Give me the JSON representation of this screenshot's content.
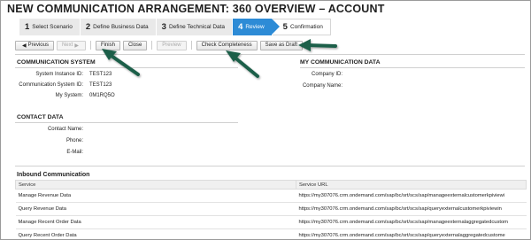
{
  "page": {
    "title": "NEW COMMUNICATION ARRANGEMENT: 360 OVERVIEW – ACCOUNT"
  },
  "steps": [
    {
      "num": "1",
      "label": "Select Scenario"
    },
    {
      "num": "2",
      "label": "Define Business Data"
    },
    {
      "num": "3",
      "label": "Define Technical Data"
    },
    {
      "num": "4",
      "label": "Review"
    },
    {
      "num": "5",
      "label": "Confirmation"
    }
  ],
  "toolbar": {
    "previous_label": "Previous",
    "next_label": "Next",
    "finish_label": "Finish",
    "close_label": "Close",
    "preview_label": "Preview",
    "check_label": "Check Completeness",
    "draft_label": "Save as Draft"
  },
  "communication_system": {
    "title": "COMMUNICATION SYSTEM",
    "fields": [
      {
        "label": "System Instance ID:",
        "value": "TEST123"
      },
      {
        "label": "Communication System ID:",
        "value": "TEST123"
      },
      {
        "label": "My System:",
        "value": "0M1RQ5O"
      }
    ]
  },
  "my_communication_data": {
    "title": "MY COMMUNICATION DATA",
    "fields": [
      {
        "label": "Company ID:",
        "value": ""
      },
      {
        "label": "Company Name:",
        "value": ""
      }
    ]
  },
  "contact_data": {
    "title": "CONTACT DATA",
    "fields": [
      {
        "label": "Contact Name:",
        "value": ""
      },
      {
        "label": "Phone:",
        "value": ""
      },
      {
        "label": "E-Mail:",
        "value": ""
      }
    ]
  },
  "inbound": {
    "title": "Inbound Communication",
    "columns": [
      "Service",
      "Service URL"
    ],
    "rows": [
      {
        "service": "Manage Revenue Data",
        "url": "https://my307076.crm.ondemand.com/sap/bc/srt/scs/sap/manageexternalcustomerkpiviewi"
      },
      {
        "service": "Query Revenue Data",
        "url": "https://my307076.crm.ondemand.com/sap/bc/srt/scs/sap/queryexternalcustomerkpiviewin"
      },
      {
        "service": "Manage Recent Order Data",
        "url": "https://my307076.crm.ondemand.com/sap/bc/srt/scs/sap/manageexternalaggregatedcustom"
      },
      {
        "service": "Query Recent Order Data",
        "url": "https://my307076.crm.ondemand.com/sap/bc/srt/scs/sap/queryexternalaggregatedcustome"
      }
    ]
  },
  "colors": {
    "active_step": "#2d8bd6",
    "callout_arrow": "#1f5e4a"
  }
}
